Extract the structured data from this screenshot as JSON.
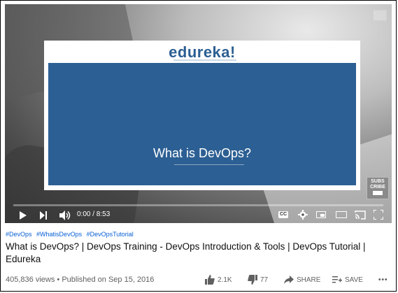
{
  "player": {
    "brand": "edureka!",
    "card_title": "What is DevOps?",
    "time": "0:00 / 8:53",
    "progress_fraction": 0,
    "cc_label": "CC",
    "subscribe_label": "SUBS CRIBE"
  },
  "video": {
    "hashtags": [
      "#DevOps",
      "#WhatisDevOps",
      "#DevOpsTutorial"
    ],
    "title": "What is DevOps? | DevOps Training - DevOps Introduction & Tools | DevOps Tutorial | Edureka",
    "views": "405,836 views",
    "separator": "•",
    "published": "Published on Sep 15, 2016"
  },
  "actions": {
    "likes": "2.1K",
    "dislikes": "77",
    "share": "SHARE",
    "save": "SAVE",
    "more": "•••"
  },
  "colors": {
    "brand_blue": "#2c5f93",
    "hashtag_blue": "#065fd4",
    "progress_red": "#ff0000"
  }
}
